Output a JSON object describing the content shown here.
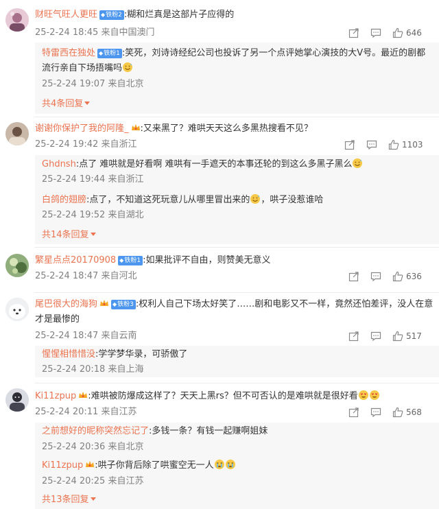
{
  "comments": [
    {
      "user": "财旺气旺人更旺",
      "badge": "铁粉2",
      "text": ":糊和烂真是这部片子应得的",
      "meta": "25-2-24 18:45 来自中国澳门",
      "likes": "646",
      "replies": [
        {
          "user": "特雷西在独处",
          "badge": "铁粉1",
          "text": ":笑死，刘诗诗经纪公司也投诉了另一个点评她掌心演技的大V号。最近的剧都流行亲自下场捂嘴吗",
          "meta": "25-2-24 19:07 来自北京"
        }
      ],
      "more": "共4条回复"
    },
    {
      "user": "谢谢你保护了我的阿隆_",
      "text": ":又来黑了？难哄天天这么多黑热搜看不见？",
      "meta": "25-2-24 19:42 来自浙江",
      "likes": "1103",
      "replies": [
        {
          "user": "Ghdnsh",
          "text": ":点了 难哄就是好看啊 难哄有一手遮天的本事还轮的到这么多黑子黑么",
          "meta": "25-2-24 19:44 来自浙江"
        },
        {
          "user": "白鸽的翅膀",
          "text": ":点了，不知道这死玩意儿从哪里冒出来的",
          "text2": "，哄子没惹谁哈",
          "meta": "25-2-24 19:52 来自湖北"
        }
      ],
      "more": "共14条回复"
    },
    {
      "user": "繁星点点20170908",
      "badge": "铁粉1",
      "text": ":如果批评不自由，则赞美无意义",
      "meta": "25-2-24 18:47 来自河北",
      "likes": "636"
    },
    {
      "user": "尾巴很大的海狗",
      "badge": "铁粉3",
      "text": ":权利人自己下场太好笑了……剧和电影又不一样，竟然还怕差评，没人在意才是最惨的",
      "meta": "25-2-24 18:47 来自云南",
      "likes": "517",
      "replies": [
        {
          "user": "惺惺相惜惜没",
          "text": ":学学梦华录，可骄傲了",
          "meta": "25-2-24 20:18 来自上海"
        }
      ]
    },
    {
      "user": "Ki11zpup",
      "text": ":难哄被防爆成这样了？天天上黑rs？但不可否认的是难哄就是很好看",
      "meta": "25-2-24 20:11 来自江苏",
      "likes": "568",
      "replies": [
        {
          "user": "之前想好的昵称突然忘记了",
          "text": ":多钱一条？有钱一起赚啊姐妹",
          "meta": "25-2-24 20:36 来自北京"
        },
        {
          "user": "Ki11zpup",
          "text": ":哄子你背后除了哄蜜空无一人",
          "meta": "25-2-24 20:25 来自江苏"
        }
      ],
      "more": "共13条回复"
    }
  ],
  "icons": {
    "share": "share-icon",
    "comment": "comment-icon",
    "like": "thumbs-up-icon",
    "badge": "diamond-icon",
    "crown": "crown-icon"
  },
  "colors": {
    "username": "#eb7350",
    "badge": "#4c96f0",
    "meta": "#808080",
    "reply_bg": "#f7f7f7"
  }
}
